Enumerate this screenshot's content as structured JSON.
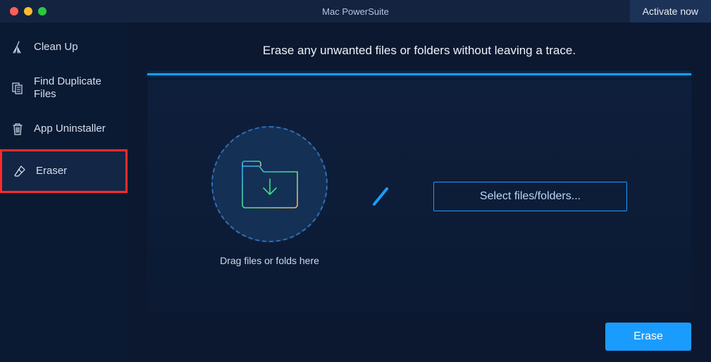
{
  "titlebar": {
    "title": "Mac PowerSuite",
    "activate_label": "Activate now"
  },
  "sidebar": {
    "items": [
      {
        "label": "Clean Up",
        "icon": "broom-icon"
      },
      {
        "label": "Find Duplicate Files",
        "icon": "duplicate-icon"
      },
      {
        "label": "App Uninstaller",
        "icon": "trash-icon"
      },
      {
        "label": "Eraser",
        "icon": "eraser-icon"
      }
    ],
    "selected_index": 3
  },
  "main": {
    "headline": "Erase any unwanted files or folders without leaving a trace.",
    "dropzone_label": "Drag files or folds here",
    "select_button_label": "Select files/folders...",
    "erase_button_label": "Erase"
  }
}
